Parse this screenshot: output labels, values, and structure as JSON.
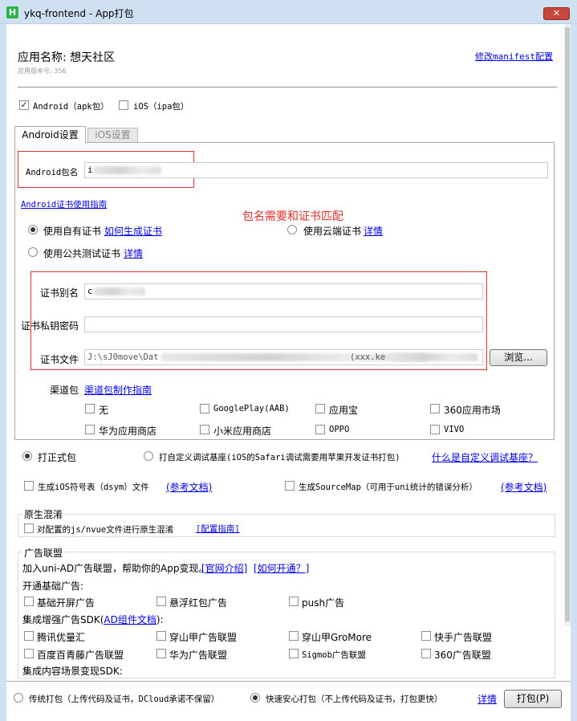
{
  "window": {
    "logo": "H",
    "title": "ykq-frontend - App打包",
    "close_label": "✕"
  },
  "header": {
    "app_name": "应用名称: 想天社区",
    "app_version": "应用版本号: 356",
    "manifest_link": "修改manifest配置"
  },
  "platforms": {
    "android_label": "Android（apk包）",
    "android_checked": true,
    "ios_label": "iOS（ipa包）",
    "ios_checked": false
  },
  "tabs": [
    {
      "label": "Android设置",
      "active": true
    },
    {
      "label": "iOS设置",
      "active": false
    }
  ],
  "android": {
    "package_label": "Android包名",
    "package_value": "i",
    "cert_guide_link": "Android证书使用指南",
    "annotation": "包名需要和证书匹配",
    "own_cert_label": "使用自有证书",
    "own_cert_link": "如何生成证书",
    "cloud_cert_label": "使用云端证书",
    "cloud_cert_link": "详情",
    "public_cert_label": "使用公共测试证书",
    "public_cert_link": "详情",
    "alias_label": "证书别名",
    "alias_value": "c",
    "password_label": "证书私钥密码",
    "password_value": "",
    "file_label": "证书文件",
    "file_value": "J:\\sJ0move\\Dat",
    "file_value_tail": "(xxx.ke",
    "browse_label": "浏览...",
    "channel_label": "渠道包",
    "channel_link": "渠道包制作指南",
    "channels": [
      "无",
      "GooglePlay(AAB)",
      "应用宝",
      "360应用市场",
      "华为应用商店",
      "小米应用商店",
      "OPPO",
      "VIVO"
    ]
  },
  "build_mode": {
    "formal_label": "打正式包",
    "custom_label": "打自定义调试基座(iOS的Safari调试需要用苹果开发证书打包)",
    "custom_link": "什么是自定义调试基座？"
  },
  "options": {
    "dsym_label": "生成iOS符号表（dsym）文件",
    "dsym_link": "(参考文档)",
    "sourcemap_label": "生成SourceMap（可用于uni统计的错误分析）",
    "sourcemap_link": "(参考文档)"
  },
  "obfuscation": {
    "title": "原生混淆",
    "label": "对配置的js/nvue文件进行原生混淆",
    "link": "[配置指南]"
  },
  "ads": {
    "title": "广告联盟",
    "intro": "加入uni-AD广告联盟，帮助你的App变现。",
    "link_intro": "[官网介绍]",
    "link_open": "[如何开通？]",
    "basic_title": "开通基础广告:",
    "basic": [
      "基础开屏广告",
      "悬浮红包广告",
      "push广告"
    ],
    "enhanced_title_prefix": "集成增强广告SDK(",
    "enhanced_title_link": "AD组件文档",
    "enhanced_title_suffix": "):",
    "enhanced": [
      "腾讯优量汇",
      "穿山甲广告联盟",
      "穿山甲GroMore",
      "快手广告联盟",
      "百度百青藤广告联盟",
      "华为广告联盟",
      "Sigmob广告联盟",
      "360广告联盟"
    ],
    "scene_title": "集成内容场景变现SDK:"
  },
  "footer": {
    "traditional_label": "传统打包（上传代码及证书，DCloud承诺不保留）",
    "safe_label": "快速安心打包（不上传代码及证书，打包更快）",
    "details_link": "详情",
    "pack_button": "打包(P)"
  }
}
